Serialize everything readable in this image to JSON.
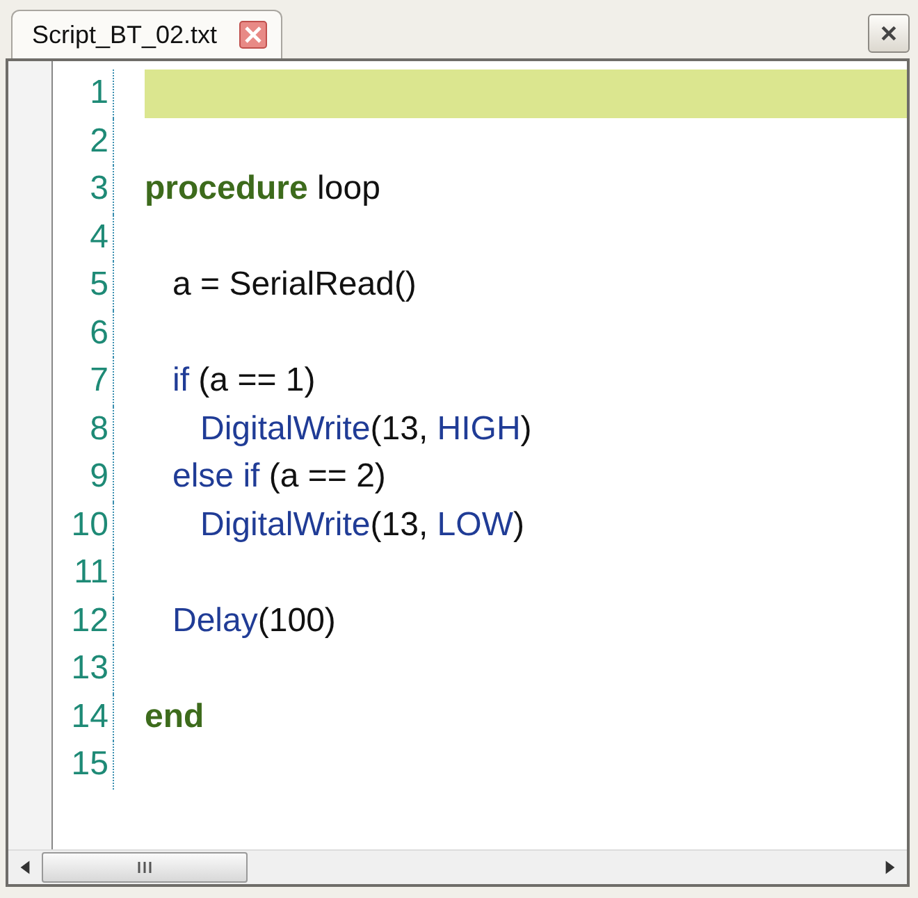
{
  "tabs": [
    {
      "label": "Script_BT_02.txt",
      "selected": true
    }
  ],
  "lines": [
    {
      "number": "1",
      "current": true
    },
    {
      "number": "2",
      "current": false
    },
    {
      "number": "3",
      "current": false,
      "tokens": [
        {
          "kind": "keyword",
          "text": "procedure"
        },
        {
          "kind": "plain",
          "text": " loop"
        }
      ]
    },
    {
      "number": "4",
      "current": false
    },
    {
      "number": "5",
      "current": false,
      "tokens": [
        {
          "kind": "plain",
          "text": "   a = SerialRead()"
        }
      ]
    },
    {
      "number": "6",
      "current": false
    },
    {
      "number": "7",
      "current": false,
      "tokens": [
        {
          "kind": "function",
          "text": "   if"
        },
        {
          "kind": "plain",
          "text": " (a == 1)"
        }
      ]
    },
    {
      "number": "8",
      "current": false,
      "tokens": [
        {
          "kind": "function",
          "text": "      DigitalWrite"
        },
        {
          "kind": "plain",
          "text": "(13, "
        },
        {
          "kind": "function",
          "text": "HIGH"
        },
        {
          "kind": "plain",
          "text": ")"
        }
      ]
    },
    {
      "number": "9",
      "current": false,
      "tokens": [
        {
          "kind": "function",
          "text": "   else if"
        },
        {
          "kind": "plain",
          "text": " (a == 2)"
        }
      ]
    },
    {
      "number": "10",
      "current": false,
      "tokens": [
        {
          "kind": "function",
          "text": "      DigitalWrite"
        },
        {
          "kind": "plain",
          "text": "(13, "
        },
        {
          "kind": "function",
          "text": "LOW"
        },
        {
          "kind": "plain",
          "text": ")"
        }
      ]
    },
    {
      "number": "11",
      "current": false
    },
    {
      "number": "12",
      "current": false,
      "tokens": [
        {
          "kind": "function",
          "text": "   Delay"
        },
        {
          "kind": "plain",
          "text": "(100)"
        }
      ]
    },
    {
      "number": "13",
      "current": false
    },
    {
      "number": "14",
      "current": false,
      "tokens": [
        {
          "kind": "keyword",
          "text": "end"
        }
      ]
    },
    {
      "number": "15",
      "current": false
    }
  ]
}
